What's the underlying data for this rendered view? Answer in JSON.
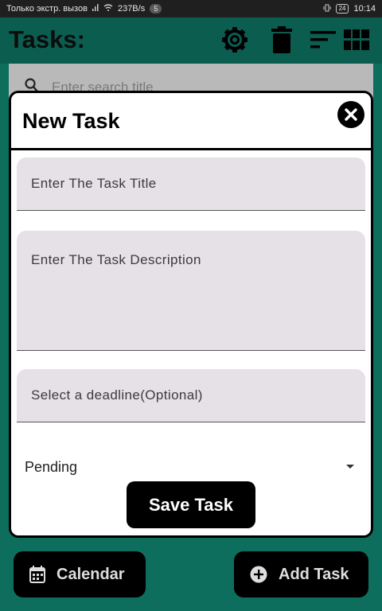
{
  "status_bar": {
    "carrier": "Только экстр. вызов",
    "net_speed": "237B/s",
    "notif_count": "5",
    "battery": "24",
    "time": "10:14"
  },
  "app": {
    "title": "Tasks:",
    "toolbar_icons": [
      "gear-icon",
      "trash-icon",
      "sort-icon",
      "grid-icon"
    ]
  },
  "search": {
    "placeholder": "Enter search title"
  },
  "dialog": {
    "title": "New Task",
    "title_field": {
      "label": "Enter The Task Title",
      "value": ""
    },
    "description_field": {
      "label": "Enter The Task Description",
      "value": ""
    },
    "deadline_field": {
      "label": "Select a deadline(Optional)",
      "value": ""
    },
    "status_select": {
      "selected": "Pending"
    },
    "save_label": "Save Task"
  },
  "bottom_bar": {
    "calendar_label": "Calendar",
    "add_label": "Add Task"
  },
  "colors": {
    "background": "#0d6e5e",
    "field_fill": "#e6e0e7",
    "button": "#000000"
  }
}
